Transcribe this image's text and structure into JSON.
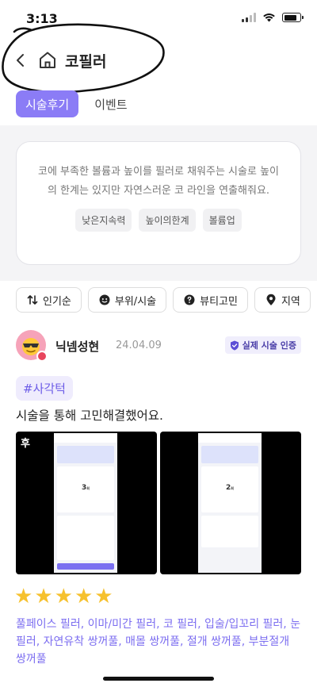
{
  "status_bar": {
    "time": "3:13"
  },
  "header": {
    "title": "코필러"
  },
  "tabs": [
    {
      "label": "시술후기",
      "active": true
    },
    {
      "label": "이벤트",
      "active": false
    }
  ],
  "intro": {
    "description": "코에 부족한 볼륨과 높이를 필러로 채워주는 시술로 높이의 한계는 있지만 자연스러운 코 라인을 연출해줘요.",
    "tags": [
      "낮은지속력",
      "높이의한계",
      "볼륨업"
    ]
  },
  "filters": [
    {
      "label": "인기순",
      "icon": "sort-icon"
    },
    {
      "label": "부위/시술",
      "icon": "face-icon"
    },
    {
      "label": "뷰티고민",
      "icon": "question-icon"
    },
    {
      "label": "지역",
      "icon": "location-icon"
    },
    {
      "label": "",
      "icon": "price-icon"
    }
  ],
  "post": {
    "user_name": "닉넴성현",
    "date": "24.04.09",
    "verified_label": "실제 시술 인증",
    "hashtag": "#사각턱",
    "body": "시술을 통해 고민해결했어요.",
    "photos": [
      {
        "label": "후",
        "count": "3",
        "count_unit": "회"
      },
      {
        "label": "",
        "count": "2",
        "count_unit": "회"
      }
    ],
    "rating": 5,
    "stars": [
      "★",
      "★",
      "★",
      "★",
      "★"
    ],
    "treatment_tags": "풀페이스 필러, 이마/미간 필러, 코 필러, 입술/입꼬리 필러, 눈필러, 자연유착 쌍꺼풀, 매몰 쌍꺼풀, 절개 쌍꺼풀, 부분절개 쌍꺼풀"
  },
  "colors": {
    "accent": "#8b7cf6",
    "tag_text": "#7c6ef0",
    "star": "#f6c12e"
  }
}
